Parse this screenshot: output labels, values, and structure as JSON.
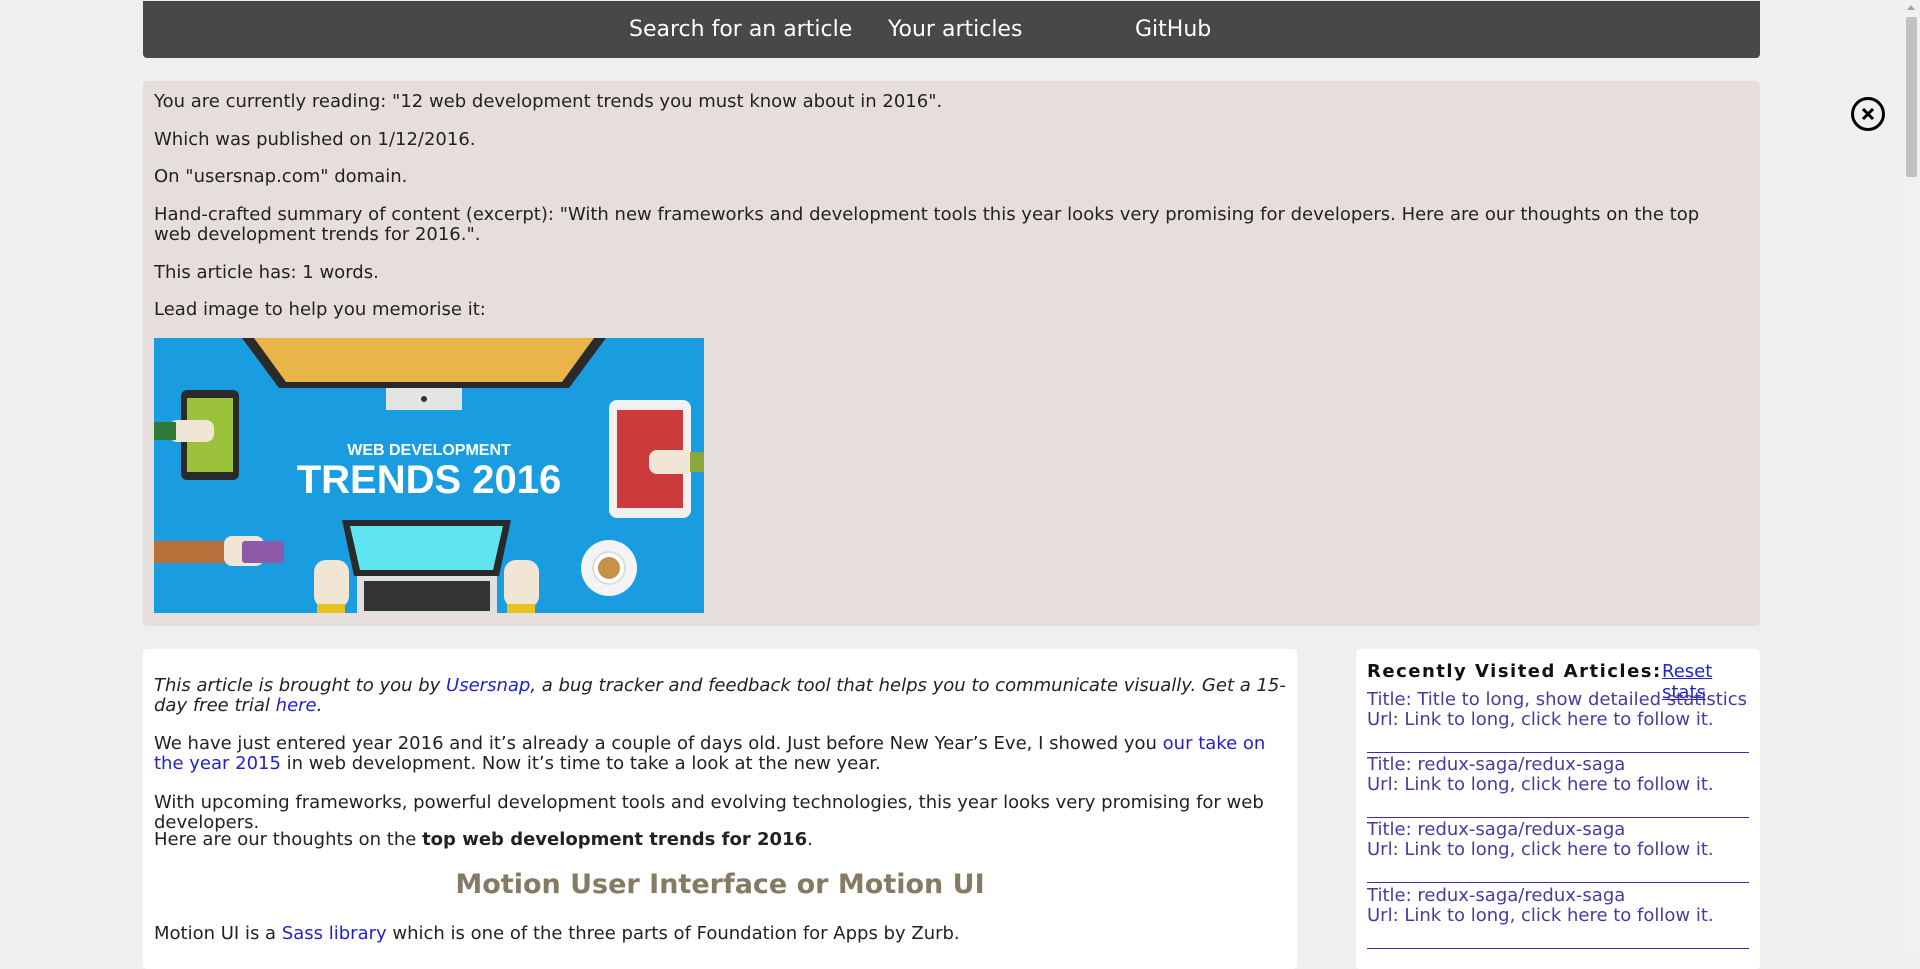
{
  "nav": {
    "search": "Search for an article",
    "articles": "Your articles",
    "github": "GitHub"
  },
  "reading": {
    "line1": "You are currently reading: \"12 web development trends you must know about in 2016\".",
    "line2": "Which was published on 1/12/2016.",
    "line3": "On \"usersnap.com\" domain.",
    "line4": "Hand-crafted summary of content (excerpt): \"With new frameworks and development tools this year looks very promising for developers. Here are our thoughts on the top web development trends for 2016.\".",
    "line5": "This article has: 1 words.",
    "line6": "Lead image to help you memorise it:",
    "image": {
      "kicker": "WEB DEVELOPMENT",
      "headline": "TRENDS 2016"
    }
  },
  "article": {
    "intro_pre": "This article is brought to you by ",
    "intro_link": "Usersnap",
    "intro_mid": ", a bug tracker and feedback tool that helps you to communicate visually. Get a 15-day free trial ",
    "intro_link2": "here",
    "intro_end": ".",
    "p1_pre": "We have just entered year 2016 and it’s already a couple of days old. Just before New Year’s Eve, I showed you ",
    "p1_link": "our take on the year 2015",
    "p1_post": " in web development. Now it’s time to take a look at the new year.",
    "p2": "With upcoming frameworks, powerful development tools and evolving technologies, this year looks very promising for web developers.",
    "p3_pre": "Here are our thoughts on the ",
    "p3_bold": "top web development trends for 2016",
    "p3_post": ".",
    "heading": "Motion User Interface or Motion UI",
    "p4_pre": "Motion UI is a ",
    "p4_link": "Sass library",
    "p4_post": " which is one of the three parts of Foundation for Apps by Zurb."
  },
  "sidebar": {
    "title": "Recently Visited Articles:",
    "reset": "Reset stats",
    "items": [
      {
        "title": "Title: Title to long, show detailed statistics.",
        "url": "Url: Link to long, click here to follow it."
      },
      {
        "title": "Title: redux-saga/redux-saga",
        "url": "Url: Link to long, click here to follow it."
      },
      {
        "title": "Title: redux-saga/redux-saga",
        "url": "Url: Link to long, click here to follow it."
      },
      {
        "title": "Title: redux-saga/redux-saga",
        "url": "Url: Link to long, click here to follow it."
      }
    ]
  },
  "colors": {
    "topbar": "#484848",
    "reading_bg": "#e6dedb",
    "heading": "#857a62",
    "link": "#2222cc",
    "visited": "#4a3aa0"
  }
}
